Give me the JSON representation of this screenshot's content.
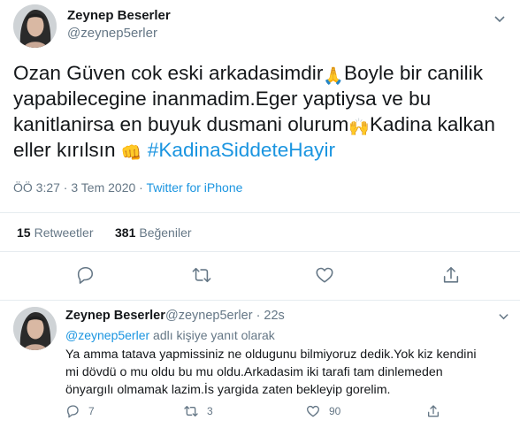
{
  "main_tweet": {
    "author_name": "Zeynep Beserler",
    "author_handle": "@zeynep5erler",
    "text_lines": [
      [
        "Ozan Güven  cok eski arkadasimdir",
        "Boyle bir canilik"
      ],
      [
        "yapabilecegine inanmadim.Eger yaptiysa ve bu"
      ],
      [
        "kanitlanirsa en buyuk dusmani olurum",
        "Kadina kalkan"
      ],
      [
        "eller kırılsın ",
        "#KadinaSiddeteHayir"
      ]
    ],
    "emojis": {
      "pray": "🙏",
      "raised_hands": "🙌",
      "fist": "👊"
    },
    "timestamp": "ÖÖ 3:27 · 3 Tem 2020 · ",
    "source": "Twitter for iPhone",
    "retweet_count": "15",
    "retweet_label": "Retweetler",
    "like_count": "381",
    "like_label": "Beğeniler"
  },
  "reply_tweet": {
    "author_name": "Zeynep Beserler",
    "author_handle": "@zeynep5erler · 22s",
    "replying_mention": "@zeynep5erler",
    "replying_suffix": " adlı kişiye yanıt olarak",
    "text_lines": [
      "Ya amma tatava yapmissiniz ne oldugunu bilmiyoruz dedik.Yok kiz kendini",
      "mi dövdü o mu oldu bu mu oldu.Arkadasim iki tarafi tam dinlemeden",
      "önyargılı olmamak lazim.İs yargida zaten bekleyip gorelim."
    ],
    "reply_count": "7",
    "retweet_count": "3",
    "like_count": "90"
  },
  "colors": {
    "accent": "#1b95e0",
    "muted": "#657786",
    "text": "#14171a",
    "border": "#e6ecf0"
  },
  "icons": [
    "avatar",
    "chevron-down-icon",
    "reply-icon",
    "retweet-icon",
    "like-icon",
    "share-icon"
  ]
}
